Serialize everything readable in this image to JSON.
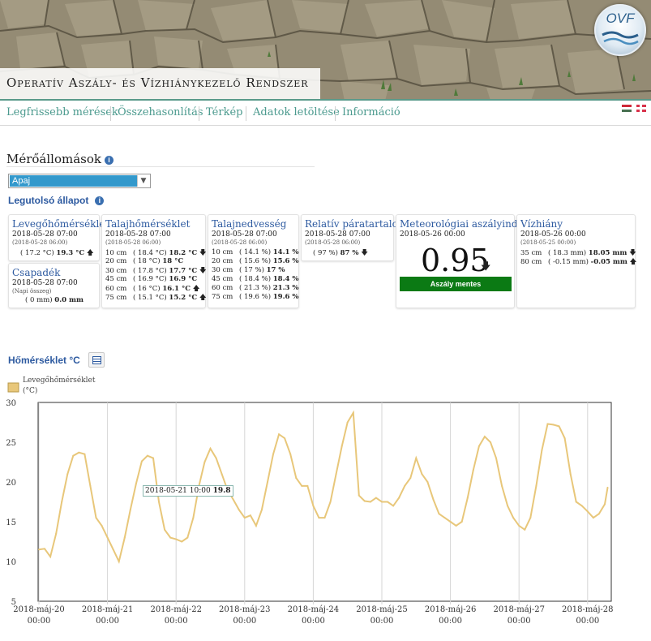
{
  "header": {
    "title": "Operatív Aszály- és Vízhiánykezelő Rendszer",
    "logo_text": "OVF"
  },
  "nav": {
    "items": [
      "Legfrissebb mérések",
      "Összehasonlítás",
      "Térkép",
      "Adatok letöltése",
      "Információ"
    ]
  },
  "stations": {
    "title": "Mérőállomások",
    "selected": "Apaj",
    "info_icon": "info-icon"
  },
  "last_state": {
    "title": "Legutolsó állapot"
  },
  "cards": {
    "air_temp": {
      "title": "Levegőhőmérséklet",
      "date": "2018-05-28 07:00",
      "sub": "(2018-05-28 06:00)",
      "prev": "( 17.2 °C)",
      "value": "19.3 °C",
      "arrow": "🡅"
    },
    "precip": {
      "title": "Csapadék",
      "date": "2018-05-28 07:00",
      "sub": "(Napi összeg)",
      "prev": "( 0 mm)",
      "value": "0.0 mm"
    },
    "soil_temp": {
      "title": "Talajhőmérséklet",
      "date": "2018-05-28 07:00",
      "sub": "(2018-05-28 06:00)",
      "rows": [
        {
          "depth": "10 cm",
          "prev": "( 18.4 °C)",
          "value": "18.2 °C",
          "arrow": "🡇"
        },
        {
          "depth": "20 cm",
          "prev": "( 18 °C)",
          "value": "18 °C",
          "arrow": ""
        },
        {
          "depth": "30 cm",
          "prev": "( 17.8 °C)",
          "value": "17.7 °C",
          "arrow": "🡇"
        },
        {
          "depth": "45 cm",
          "prev": "( 16.9 °C)",
          "value": "16.9 °C",
          "arrow": ""
        },
        {
          "depth": "60 cm",
          "prev": "( 16 °C)",
          "value": "16.1 °C",
          "arrow": "🡅"
        },
        {
          "depth": "75 cm",
          "prev": "( 15.1 °C)",
          "value": "15.2 °C",
          "arrow": "🡅"
        }
      ]
    },
    "soil_moist": {
      "title": "Talajnedvesség",
      "date": "2018-05-28 07:00",
      "sub": "(2018-05-28 06:00)",
      "rows": [
        {
          "depth": "10 cm",
          "prev": "( 14.1 %)",
          "value": "14.1 %",
          "arrow": ""
        },
        {
          "depth": "20 cm",
          "prev": "( 15.6 %)",
          "value": "15.6 %",
          "arrow": ""
        },
        {
          "depth": "30 cm",
          "prev": "( 17 %)",
          "value": "17 %",
          "arrow": ""
        },
        {
          "depth": "45 cm",
          "prev": "( 18.4 %)",
          "value": "18.4 %",
          "arrow": ""
        },
        {
          "depth": "60 cm",
          "prev": "( 21.3 %)",
          "value": "21.3 %",
          "arrow": ""
        },
        {
          "depth": "75 cm",
          "prev": "( 19.6 %)",
          "value": "19.6 %",
          "arrow": ""
        }
      ]
    },
    "humidity": {
      "title": "Relatív páratartalom",
      "date": "2018-05-28 07:00",
      "sub": "(2018-05-28 06:00)",
      "prev": "( 97 %)",
      "value": "87 %",
      "arrow": "🡇"
    },
    "drought": {
      "title": "Meteorológiai aszályindex",
      "date": "2018-05-26 00:00",
      "value": "0.95",
      "arrow": "🡇",
      "status": "Aszály mentes",
      "status_color": "#0b7a14"
    },
    "water": {
      "title": "Vízhiány",
      "date": "2018-05-26 00:00",
      "sub": "(2018-05-25 00:00)",
      "rows": [
        {
          "depth": "35 cm",
          "prev": "( 18.3 mm)",
          "value": "18.05 mm",
          "arrow": "🡇"
        },
        {
          "depth": "80 cm",
          "prev": "( -0.15 mm)",
          "value": "-0.05 mm",
          "arrow": "🡅"
        }
      ]
    }
  },
  "chart_section": {
    "title": "Hőmérséklet °C",
    "table_icon": "table-icon"
  },
  "tooltip": {
    "date": "2018-05-21 10:00",
    "value": "19.8"
  },
  "chart_data": {
    "type": "line",
    "legend": "Levegőhőmérséklet (°C)",
    "color": "#e8c77a",
    "ylim": [
      5,
      30
    ],
    "yticks": [
      5,
      10,
      15,
      20,
      25,
      30
    ],
    "xlim": [
      "2018-05-20 00:00",
      "2018-05-28 08:00"
    ],
    "xticks": [
      {
        "date": "2018-máj-20",
        "time": "00:00"
      },
      {
        "date": "2018-máj-21",
        "time": "00:00"
      },
      {
        "date": "2018-máj-22",
        "time": "00:00"
      },
      {
        "date": "2018-máj-23",
        "time": "00:00"
      },
      {
        "date": "2018-máj-24",
        "time": "00:00"
      },
      {
        "date": "2018-máj-25",
        "time": "00:00"
      },
      {
        "date": "2018-máj-26",
        "time": "00:00"
      },
      {
        "date": "2018-máj-27",
        "time": "00:00"
      },
      {
        "date": "2018-máj-28",
        "time": "00:00"
      }
    ],
    "series": [
      {
        "name": "Levegőhőmérséklet (°C)",
        "points": [
          [
            "2018-05-20 00:00",
            11.5
          ],
          [
            "2018-05-20 02:00",
            11.6
          ],
          [
            "2018-05-20 04:00",
            10.6
          ],
          [
            "2018-05-20 06:00",
            13.5
          ],
          [
            "2018-05-20 08:00",
            17.5
          ],
          [
            "2018-05-20 10:00",
            21.0
          ],
          [
            "2018-05-20 12:00",
            23.3
          ],
          [
            "2018-05-20 14:00",
            23.7
          ],
          [
            "2018-05-20 16:00",
            23.5
          ],
          [
            "2018-05-20 18:00",
            19.5
          ],
          [
            "2018-05-20 20:00",
            15.5
          ],
          [
            "2018-05-20 22:00",
            14.5
          ],
          [
            "2018-05-21 00:00",
            13.0
          ],
          [
            "2018-05-21 02:00",
            11.5
          ],
          [
            "2018-05-21 04:00",
            10.0
          ],
          [
            "2018-05-21 06:00",
            13.0
          ],
          [
            "2018-05-21 08:00",
            16.5
          ],
          [
            "2018-05-21 10:00",
            19.8
          ],
          [
            "2018-05-21 12:00",
            22.6
          ],
          [
            "2018-05-21 14:00",
            23.3
          ],
          [
            "2018-05-21 16:00",
            23.0
          ],
          [
            "2018-05-21 18:00",
            17.5
          ],
          [
            "2018-05-21 20:00",
            14.0
          ],
          [
            "2018-05-21 22:00",
            13.0
          ],
          [
            "2018-05-22 00:00",
            12.8
          ],
          [
            "2018-05-22 02:00",
            12.5
          ],
          [
            "2018-05-22 04:00",
            13.0
          ],
          [
            "2018-05-22 06:00",
            15.5
          ],
          [
            "2018-05-22 08:00",
            19.5
          ],
          [
            "2018-05-22 10:00",
            22.5
          ],
          [
            "2018-05-22 12:00",
            24.2
          ],
          [
            "2018-05-22 14:00",
            23.0
          ],
          [
            "2018-05-22 16:00",
            21.0
          ],
          [
            "2018-05-22 18:00",
            19.0
          ],
          [
            "2018-05-22 20:00",
            17.8
          ],
          [
            "2018-05-22 22:00",
            16.5
          ],
          [
            "2018-05-23 00:00",
            15.5
          ],
          [
            "2018-05-23 02:00",
            15.8
          ],
          [
            "2018-05-23 04:00",
            14.5
          ],
          [
            "2018-05-23 06:00",
            16.5
          ],
          [
            "2018-05-23 08:00",
            20.0
          ],
          [
            "2018-05-23 10:00",
            23.5
          ],
          [
            "2018-05-23 12:00",
            26.0
          ],
          [
            "2018-05-23 14:00",
            25.5
          ],
          [
            "2018-05-23 16:00",
            23.5
          ],
          [
            "2018-05-23 18:00",
            20.5
          ],
          [
            "2018-05-23 20:00",
            19.5
          ],
          [
            "2018-05-23 22:00",
            19.5
          ],
          [
            "2018-05-24 00:00",
            17.0
          ],
          [
            "2018-05-24 02:00",
            15.5
          ],
          [
            "2018-05-24 04:00",
            15.5
          ],
          [
            "2018-05-24 06:00",
            17.5
          ],
          [
            "2018-05-24 08:00",
            21.0
          ],
          [
            "2018-05-24 10:00",
            24.5
          ],
          [
            "2018-05-24 12:00",
            27.5
          ],
          [
            "2018-05-24 14:00",
            28.7
          ],
          [
            "2018-05-24 16:00",
            18.3
          ],
          [
            "2018-05-24 18:00",
            17.6
          ],
          [
            "2018-05-24 20:00",
            17.5
          ],
          [
            "2018-05-24 22:00",
            18.0
          ],
          [
            "2018-05-25 00:00",
            17.5
          ],
          [
            "2018-05-25 02:00",
            17.5
          ],
          [
            "2018-05-25 04:00",
            17.0
          ],
          [
            "2018-05-25 06:00",
            18.0
          ],
          [
            "2018-05-25 08:00",
            19.5
          ],
          [
            "2018-05-25 10:00",
            20.5
          ],
          [
            "2018-05-25 12:00",
            23.0
          ],
          [
            "2018-05-25 14:00",
            21.0
          ],
          [
            "2018-05-25 16:00",
            20.0
          ],
          [
            "2018-05-25 18:00",
            17.8
          ],
          [
            "2018-05-25 20:00",
            16.0
          ],
          [
            "2018-05-25 22:00",
            15.5
          ],
          [
            "2018-05-26 00:00",
            15.0
          ],
          [
            "2018-05-26 02:00",
            14.5
          ],
          [
            "2018-05-26 04:00",
            15.0
          ],
          [
            "2018-05-26 06:00",
            18.0
          ],
          [
            "2018-05-26 08:00",
            21.5
          ],
          [
            "2018-05-26 10:00",
            24.5
          ],
          [
            "2018-05-26 12:00",
            25.7
          ],
          [
            "2018-05-26 14:00",
            25.0
          ],
          [
            "2018-05-26 16:00",
            23.0
          ],
          [
            "2018-05-26 18:00",
            19.5
          ],
          [
            "2018-05-26 20:00",
            17.0
          ],
          [
            "2018-05-26 22:00",
            15.5
          ],
          [
            "2018-05-27 00:00",
            14.5
          ],
          [
            "2018-05-27 02:00",
            14.0
          ],
          [
            "2018-05-27 04:00",
            15.5
          ],
          [
            "2018-05-27 06:00",
            19.5
          ],
          [
            "2018-05-27 08:00",
            24.0
          ],
          [
            "2018-05-27 10:00",
            27.3
          ],
          [
            "2018-05-27 12:00",
            27.2
          ],
          [
            "2018-05-27 14:00",
            27.0
          ],
          [
            "2018-05-27 16:00",
            25.5
          ],
          [
            "2018-05-27 18:00",
            21.0
          ],
          [
            "2018-05-27 20:00",
            17.5
          ],
          [
            "2018-05-27 22:00",
            17.0
          ],
          [
            "2018-05-28 00:00",
            16.3
          ],
          [
            "2018-05-28 02:00",
            15.5
          ],
          [
            "2018-05-28 04:00",
            16.0
          ],
          [
            "2018-05-28 06:00",
            17.2
          ],
          [
            "2018-05-28 07:00",
            19.3
          ]
        ]
      }
    ]
  }
}
